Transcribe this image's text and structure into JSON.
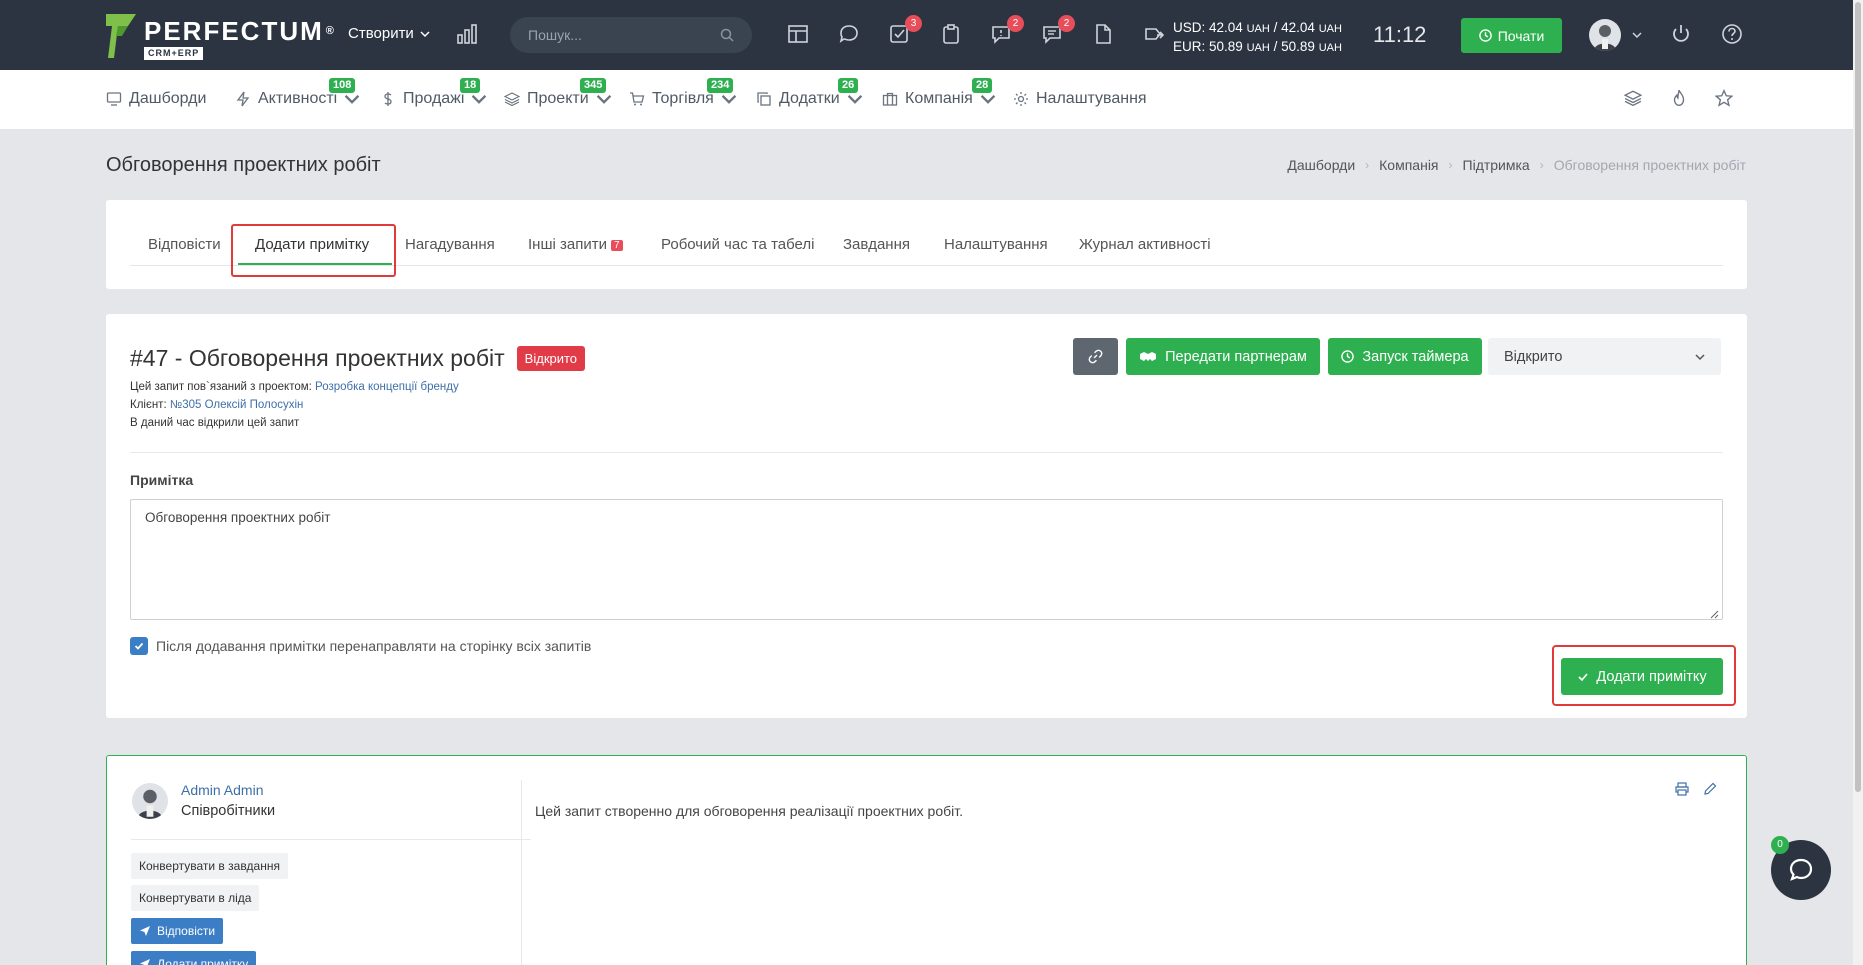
{
  "topbar": {
    "logo_name": "PERFECTUM",
    "logo_reg": "®",
    "logo_sub": "CRM+ERP",
    "create_label": "Створити",
    "search_placeholder": "Пошук...",
    "icons": [
      {
        "name": "layout-icon"
      },
      {
        "name": "chat-bubble-icon"
      },
      {
        "name": "tasks-check-icon",
        "badge": "3"
      },
      {
        "name": "clipboard-icon"
      },
      {
        "name": "messages-icon",
        "badge": "2"
      },
      {
        "name": "comments-icon",
        "badge": "2"
      },
      {
        "name": "document-icon"
      },
      {
        "name": "exchange-icon"
      }
    ],
    "usd_label": "USD:",
    "usd_value1": "42.04",
    "usd_value2": "42.04",
    "eur_label": "EUR:",
    "eur_value1": "50.89",
    "eur_value2": "50.89",
    "uah": "UAH",
    "slash": "/",
    "clock": "11:12",
    "start_label": "Почати"
  },
  "nav": {
    "items": [
      {
        "label": "Дашборди",
        "badge": ""
      },
      {
        "label": "Активності",
        "badge": "108"
      },
      {
        "label": "Продажі",
        "badge": "18"
      },
      {
        "label": "Проекти",
        "badge": "345"
      },
      {
        "label": "Торгівля",
        "badge": "234"
      },
      {
        "label": "Додатки",
        "badge": "26"
      },
      {
        "label": "Компанія",
        "badge": "28"
      },
      {
        "label": "Налаштування",
        "badge": ""
      }
    ]
  },
  "page": {
    "title": "Обговорення проектних робіт",
    "breadcrumb": [
      "Дашборди",
      "Компанія",
      "Підтримка",
      "Обговорення проектних робіт"
    ],
    "breadcrumb_sep": "›"
  },
  "tabs": [
    {
      "label": "Відповісти"
    },
    {
      "label": "Додати примітку"
    },
    {
      "label": "Нагадування"
    },
    {
      "label": "Інші запити",
      "badge": "7"
    },
    {
      "label": "Робочий час та табелі"
    },
    {
      "label": "Завдання"
    },
    {
      "label": "Налаштування"
    },
    {
      "label": "Журнал активності"
    }
  ],
  "ticket": {
    "title": "#47 - Обговорення проектних робіт",
    "status_badge": "Відкрито",
    "project_prefix": "Цей запит пов`язаний з проектом:",
    "project_link": "Розробка концепції бренду",
    "client_prefix": "Клієнт:",
    "client_link": "№305 Олексій Полосухін",
    "opened_text": "В даний час відкрили цей запит",
    "btn_partners": "Передати партнерам",
    "btn_timer": "Запуск таймера",
    "status_select": "Відкрито",
    "note_label": "Примітка",
    "note_value": "Обговорення проектних робіт",
    "checkbox_label": "Після додавання примітки перенаправляти на сторінку всіх запитів",
    "add_note_btn": "Додати примітку"
  },
  "reply": {
    "author": "Admin Admin",
    "role": "Співробітники",
    "btn_convert_task": "Конвертувати в завдання",
    "btn_convert_lead": "Конвертувати в ліда",
    "btn_reply": "Відповісти",
    "btn_add_note": "Додати примітку",
    "text": "Цей запит створенно для обговорення реалізації проектних робіт."
  },
  "chat": {
    "badge": "0"
  },
  "colors": {
    "topbar": "#2b3440",
    "accent_green": "#2fb050",
    "danger": "#e23b48",
    "link": "#3e6fa8",
    "blue": "#3b7ec6"
  }
}
